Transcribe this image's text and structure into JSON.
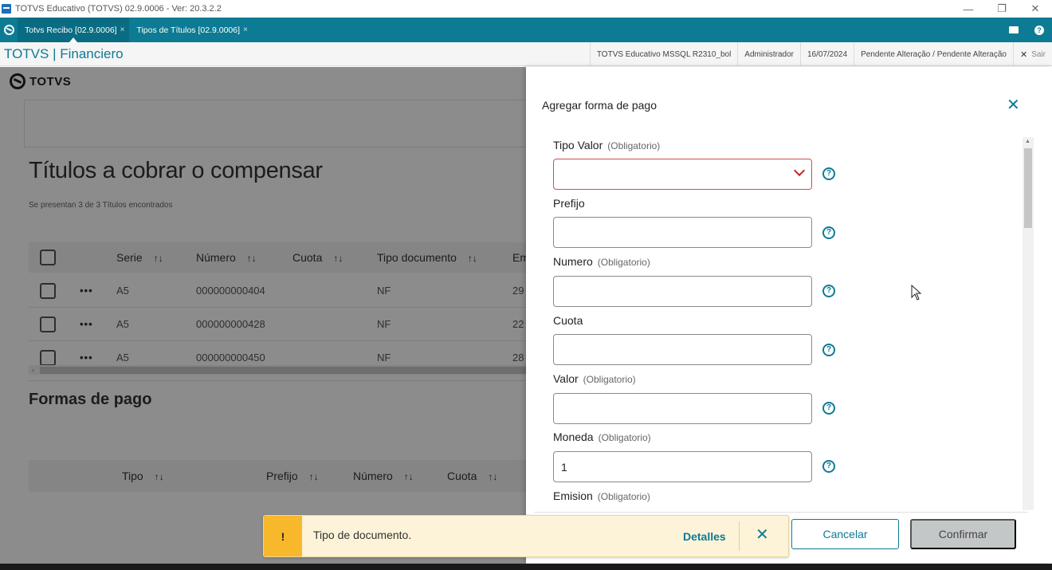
{
  "window": {
    "title": "TOTVS Educativo (TOTVS) 02.9.0006 - Ver: 20.3.2.2",
    "minimize": "—",
    "restore": "❐",
    "close": "✕"
  },
  "tabs": [
    {
      "label": "Totvs Recibo [02.9.0006]",
      "close": "×",
      "active": true
    },
    {
      "label": "Tipos de Títulos [02.9.0006]",
      "close": "×",
      "active": false
    }
  ],
  "module": {
    "title": "TOTVS | Financiero",
    "environment": "TOTVS Educativo MSSQL R2310_bol",
    "user": "Administrador",
    "date": "16/07/2024",
    "status": "Pendente Alteração / Pendente Alteração",
    "exit_label": "Sair",
    "exit_icon": "✕"
  },
  "page": {
    "logo_text": "TOTVS",
    "title": "Títulos a cobrar o compensar",
    "subtitle": "Se presentan 3 de 3 Títulos encontrados",
    "table": {
      "columns": [
        "Serie",
        "Número",
        "Cuota",
        "Tipo documento",
        "Em"
      ],
      "sort_icon": "↑↓",
      "rows": [
        {
          "serie": "A5",
          "numero": "000000000404",
          "cuota": "",
          "tipo": "NF",
          "em": "29"
        },
        {
          "serie": "A5",
          "numero": "000000000428",
          "cuota": "",
          "tipo": "NF",
          "em": "22"
        },
        {
          "serie": "A5",
          "numero": "000000000450",
          "cuota": "",
          "tipo": "NF",
          "em": "28"
        }
      ],
      "row_menu": "•••",
      "scroll_left": "‹"
    },
    "payments": {
      "title": "Formas de pago",
      "columns": [
        "Tipo",
        "Prefijo",
        "Número",
        "Cuota"
      ]
    }
  },
  "drawer": {
    "title": "Agregar forma de pago",
    "close_icon": "✕",
    "help_icon": "?",
    "required_tag": "(Obligatorio)",
    "fields": [
      {
        "label": "Tipo Valor",
        "value": ""
      },
      {
        "label": "Prefijo",
        "value": ""
      },
      {
        "label": "Numero",
        "value": ""
      },
      {
        "label": "Cuota",
        "value": ""
      },
      {
        "label": "Valor",
        "value": ""
      },
      {
        "label": "Moneda",
        "value": "1"
      },
      {
        "label": "Emision"
      }
    ],
    "cancel_label": "Cancelar",
    "confirm_label": "Confirmar",
    "scroll_up": "▲"
  },
  "toast": {
    "icon": "!",
    "message": "Tipo de documento.",
    "details_label": "Detalles",
    "close_icon": "✕"
  },
  "colors": {
    "accent": "#0c7b93",
    "warning": "#f7b92b",
    "error": "#d84a4a"
  }
}
